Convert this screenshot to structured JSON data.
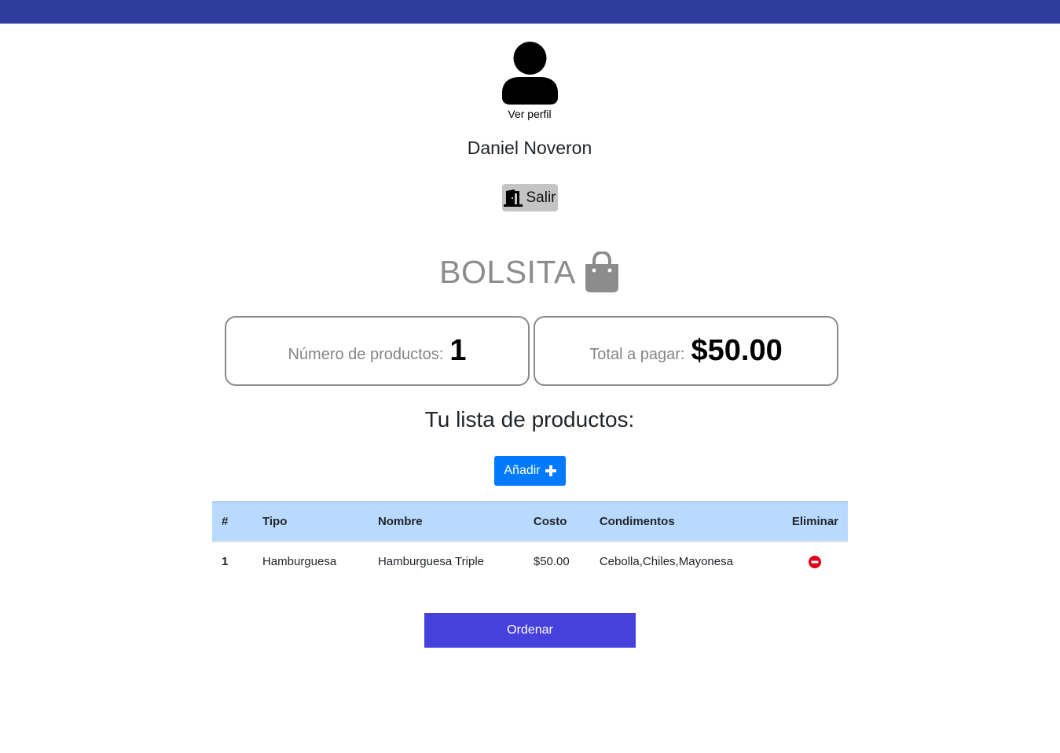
{
  "colors": {
    "topbar": "#2f3c9e",
    "add_button": "#007bff",
    "order_button": "#4640dc",
    "table_header": "#b8daff",
    "remove_icon": "#e0001a"
  },
  "profile": {
    "avatar_icon": "user-icon",
    "link_label": "Ver perfil",
    "name": "Daniel Noveron",
    "logout_icon": "door-exit-icon",
    "logout_label": "Salir"
  },
  "bag": {
    "title": "BOLSITA",
    "icon": "shopping-bag-icon",
    "count_label": "Número de productos:",
    "count_value": "1",
    "total_label": "Total a pagar:",
    "total_value": "$50.00"
  },
  "products": {
    "title": "Tu lista de productos:",
    "add_label": "Añadir",
    "add_icon": "plus-icon",
    "columns": [
      "#",
      "Tipo",
      "Nombre",
      "Costo",
      "Condimentos",
      "Eliminar"
    ],
    "rows": [
      {
        "num": "1",
        "tipo": "Hamburguesa",
        "nombre": "Hamburguesa Triple",
        "costo": "$50.00",
        "condimentos": "Cebolla,Chiles,Mayonesa",
        "remove_icon": "minus-circle-icon"
      }
    ]
  },
  "order": {
    "label": "Ordenar"
  }
}
